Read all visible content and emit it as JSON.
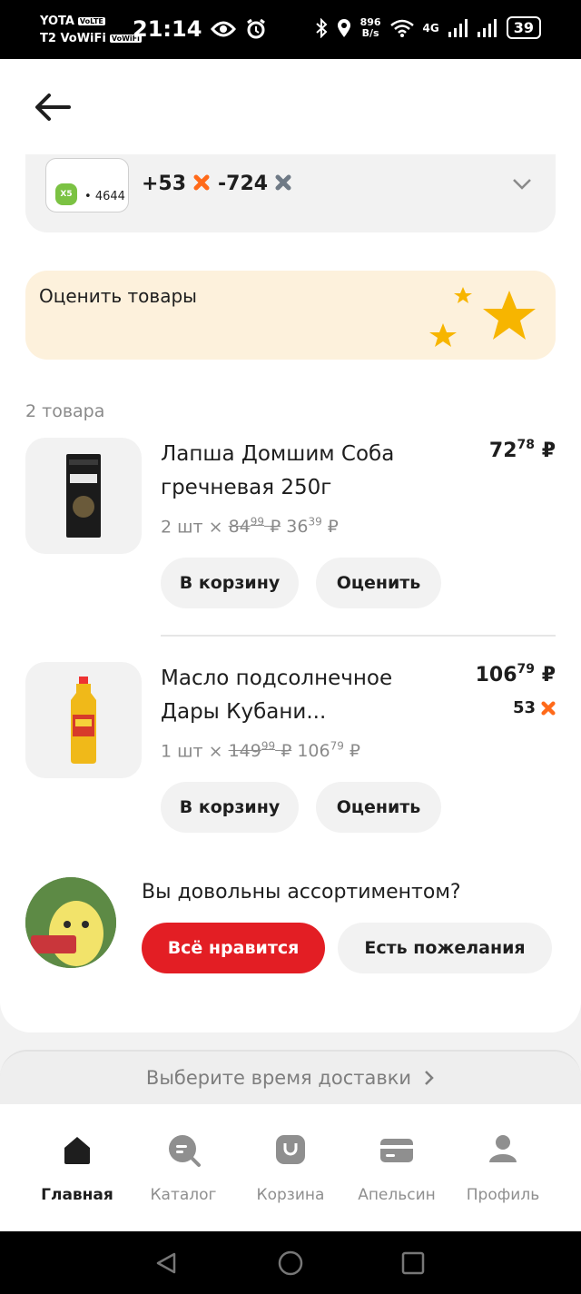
{
  "status_bar": {
    "carrier1": "YOTA",
    "carrier1_tag": "VoLTE",
    "carrier2": "T2 VoWiFi",
    "carrier2_tag": "VoWiFi",
    "time": "21:14",
    "speed_value": "896",
    "speed_unit": "B/s",
    "network": "4G",
    "battery": "39"
  },
  "bonus": {
    "logo_text": "X5",
    "card_digits": "4644",
    "plus_points": "+53",
    "minus_points": "-724"
  },
  "rate_banner": {
    "title": "Оценить товары"
  },
  "items_count": "2 товара",
  "products": [
    {
      "name": "Лапша Домшим Соба гречневая 250г",
      "price_int": "72",
      "price_frac": "78",
      "currency": "₽",
      "qty_text": "2 шт  ×",
      "old_int": "84",
      "old_frac": "99",
      "unit_int": "36",
      "unit_frac": "39",
      "cart_label": "В корзину",
      "rate_label": "Оценить",
      "bonus": null
    },
    {
      "name": "Масло подсолнечное Дары Кубани...",
      "price_int": "106",
      "price_frac": "79",
      "currency": "₽",
      "qty_text": "1 шт  ×",
      "old_int": "149",
      "old_frac": "99",
      "unit_int": "106",
      "unit_frac": "79",
      "cart_label": "В корзину",
      "rate_label": "Оценить",
      "bonus": "53"
    }
  ],
  "feedback": {
    "question": "Вы довольны ассортиментом?",
    "like_label": "Всё нравится",
    "wish_label": "Есть пожелания"
  },
  "delivery": {
    "label": "Выберите время доставки"
  },
  "tabs": [
    {
      "label": "Главная",
      "icon": "home-icon",
      "active": true
    },
    {
      "label": "Каталог",
      "icon": "catalog-search-icon",
      "active": false
    },
    {
      "label": "Корзина",
      "icon": "cart-bag-icon",
      "active": false
    },
    {
      "label": "Апельсин",
      "icon": "card-icon",
      "active": false
    },
    {
      "label": "Профиль",
      "icon": "profile-icon",
      "active": false
    }
  ],
  "colors": {
    "accent_red": "#e31e24",
    "bonus_orange": "#ff6a1a",
    "banner_bg": "#fdf1dc",
    "star_yellow": "#f7b500"
  }
}
